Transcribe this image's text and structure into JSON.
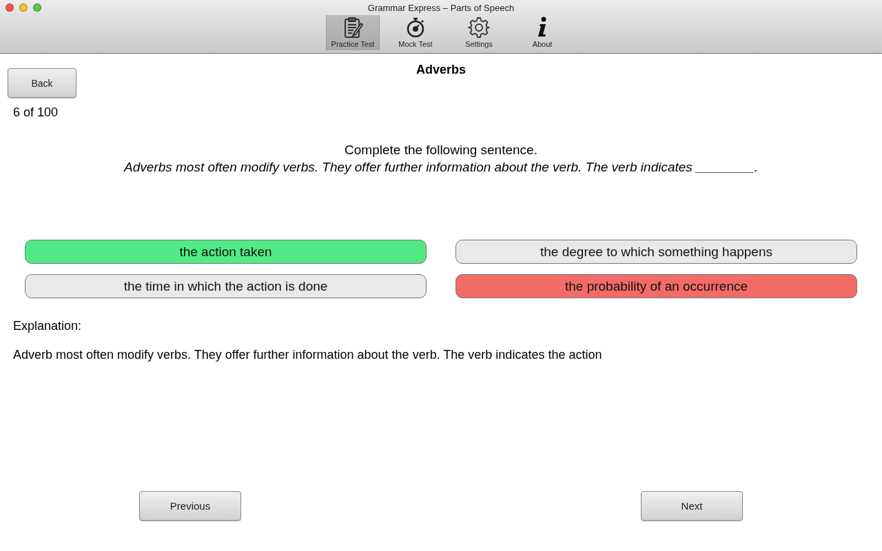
{
  "window": {
    "title": "Grammar Express – Parts of Speech"
  },
  "toolbar": [
    {
      "label": "Practice Test",
      "selected": true
    },
    {
      "label": "Mock Test",
      "selected": false
    },
    {
      "label": "Settings",
      "selected": false
    },
    {
      "label": "About",
      "selected": false
    }
  ],
  "heading": "Adverbs",
  "back_button": "Back",
  "progress": "6 of 100",
  "question": {
    "prompt": "Complete the following sentence.",
    "sentence": "Adverbs most often modify verbs. They offer further information about the verb. The verb indicates ________."
  },
  "answers": [
    {
      "text": "the action taken",
      "kind": "correct"
    },
    {
      "text": "the degree to which something happens",
      "kind": "plain"
    },
    {
      "text": "the time in which the action is done",
      "kind": "plain"
    },
    {
      "text": "the probability of an occurrence",
      "kind": "wrong"
    }
  ],
  "explanation": {
    "label": "Explanation:",
    "text": "Adverb most often modify verbs. They offer further information about the verb. The verb indicates the action"
  },
  "nav_buttons": [
    "Previous",
    "Next"
  ]
}
